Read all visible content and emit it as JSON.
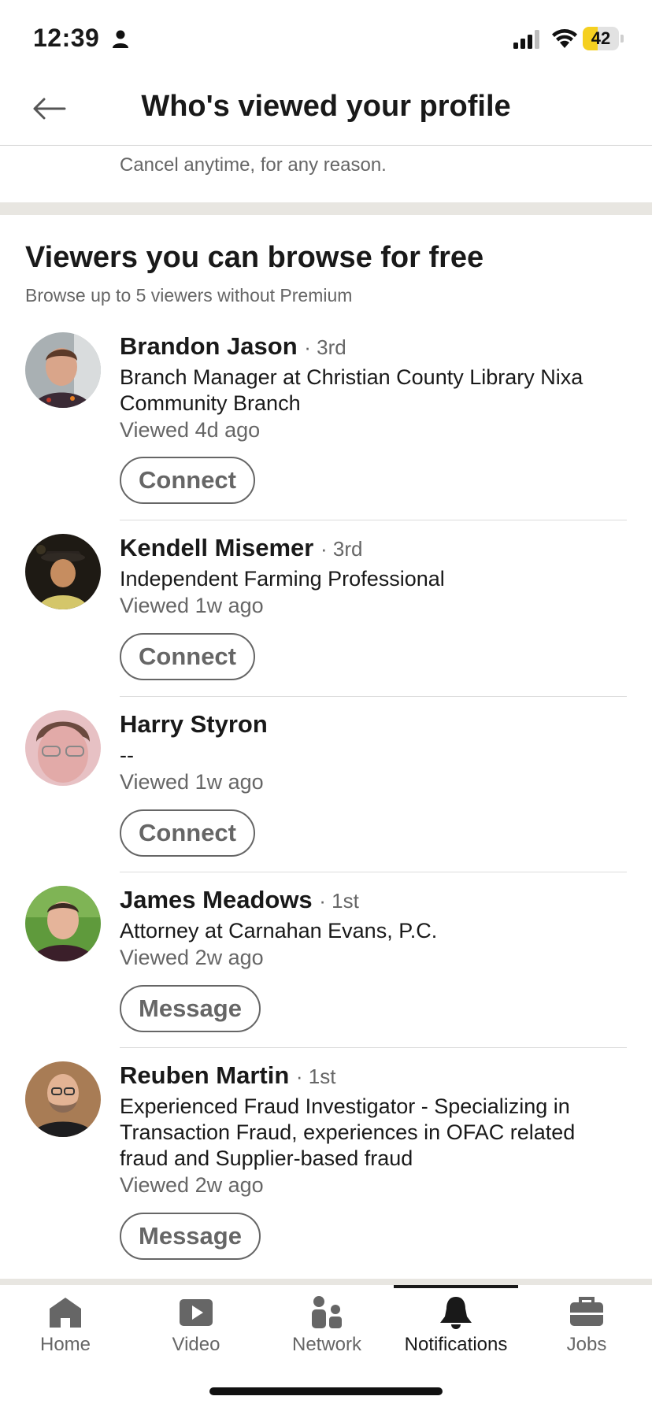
{
  "status_bar": {
    "time": "12:39",
    "battery": "42",
    "battery_level": 0.42
  },
  "header": {
    "title": "Who's viewed your profile"
  },
  "promo": {
    "cancel_text": "Cancel anytime, for any reason."
  },
  "section": {
    "title": "Viewers you can browse for free",
    "subtitle": "Browse up to 5 viewers without Premium"
  },
  "viewers": [
    {
      "name": "Brandon Jason",
      "degree": "· 3rd",
      "headline": "Branch Manager at Christian County Library Nixa Community Branch",
      "viewed": "Viewed 4d ago",
      "action": "Connect"
    },
    {
      "name": "Kendell Misemer",
      "degree": "· 3rd",
      "headline": "Independent Farming Professional",
      "viewed": "Viewed 1w ago",
      "action": "Connect"
    },
    {
      "name": "Harry Styron",
      "degree": "",
      "headline": "--",
      "viewed": "Viewed 1w ago",
      "action": "Connect"
    },
    {
      "name": "James Meadows",
      "degree": "· 1st",
      "headline": "Attorney at Carnahan Evans, P.C.",
      "viewed": "Viewed 2w ago",
      "action": "Message"
    },
    {
      "name": "Reuben Martin",
      "degree": "· 1st",
      "headline": "Experienced Fraud Investigator - Specializing in Transaction Fraud, experiences in OFAC related fraud and Supplier-based fraud",
      "viewed": "Viewed 2w ago",
      "action": "Message"
    }
  ],
  "nav": {
    "items": [
      {
        "label": "Home",
        "icon": "home-icon"
      },
      {
        "label": "Video",
        "icon": "video-icon"
      },
      {
        "label": "Network",
        "icon": "network-icon"
      },
      {
        "label": "Notifications",
        "icon": "bell-icon",
        "active": true
      },
      {
        "label": "Jobs",
        "icon": "briefcase-icon"
      }
    ]
  },
  "colors": {
    "text": "#191919",
    "muted": "#666666",
    "band": "#e8e6e1",
    "battery": "#f5d020"
  }
}
